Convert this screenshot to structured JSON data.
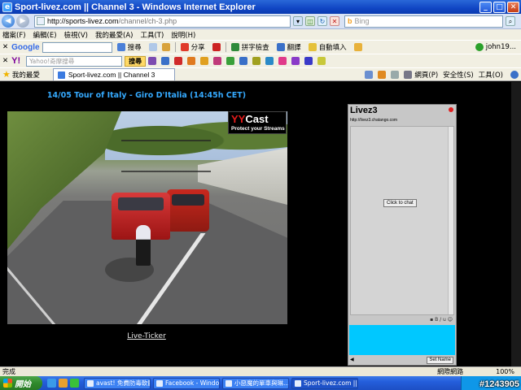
{
  "window": {
    "title": "Sport-livez.com || Channel 3 - Windows Internet Explorer"
  },
  "address": {
    "url_host": "http://sports-livez.com",
    "url_path": "/channel/ch-3.php",
    "search_placeholder": "Bing"
  },
  "menu": [
    "檔案(F)",
    "編輯(E)",
    "檢視(V)",
    "我的最愛(A)",
    "工具(T)",
    "說明(H)"
  ],
  "toolbar1": {
    "google_label": "Google",
    "items": [
      "搜尋",
      "分享",
      "拼字檢查",
      "翻譯",
      "自動填入"
    ],
    "account": "john19..."
  },
  "toolbar2": {
    "yahoo_label": "Y!",
    "search_placeholder": "Yahoo!奇摩搜尋",
    "search_button": "搜尋"
  },
  "favbar": {
    "favorites_label": "我的最愛",
    "tab_label": "Sport-livez.com || Channel 3",
    "right_items": [
      "網頁(P)",
      "安全性(S)",
      "工具(O)"
    ]
  },
  "page": {
    "video_title": "14/05 Tour of Italy - Giro D'Italia (14:45h CET)",
    "yycast_brand_yy": "YY",
    "yycast_brand_cast": "Cast",
    "yycast_tagline": "Protect your Streams",
    "live_ticker": "Live-Ticker"
  },
  "chat": {
    "title": "Livez3",
    "url": "http://livez3.chatango.com",
    "click_to_chat": "Click to chat",
    "set_name": "Set Name",
    "tools": "▪ B / u ☺"
  },
  "status": {
    "text": "完成",
    "zone": "網際網路",
    "zoom": "100%"
  },
  "taskbar": {
    "start_label": "開始",
    "tasks": [
      "avast! 免費防毒軟體",
      "Facebook - Window...",
      "小惡魔的單車與琳...",
      "Sport-livez.com || Ch..."
    ],
    "clock": "",
    "watermark": "#1243905"
  }
}
